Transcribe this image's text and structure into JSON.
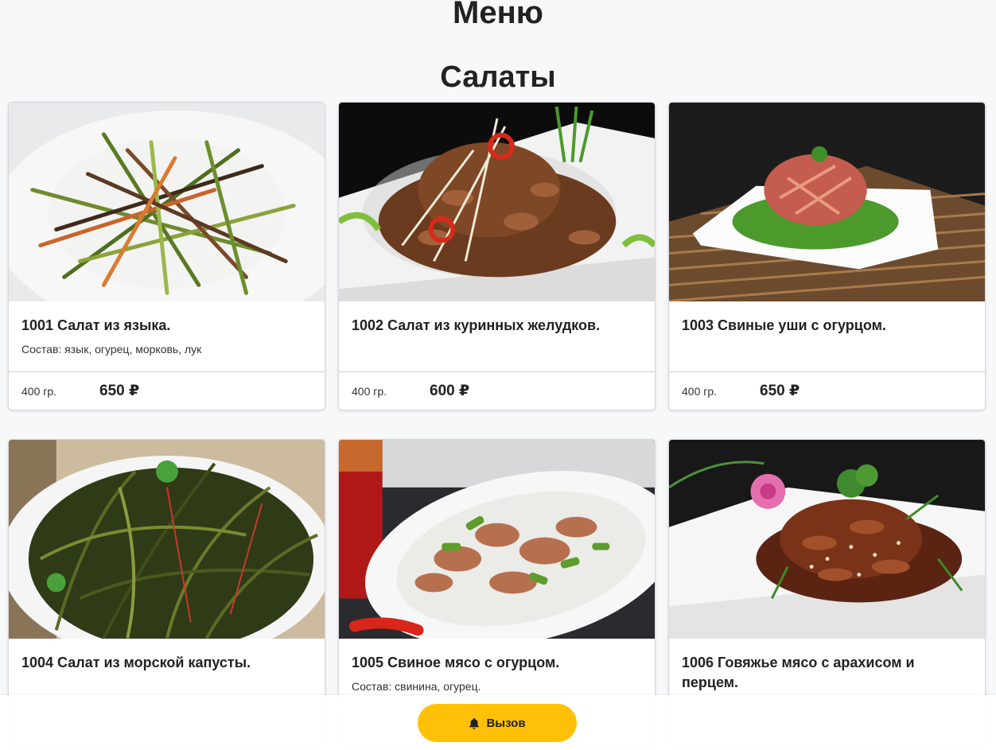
{
  "page": {
    "title": "Меню"
  },
  "section": {
    "title": "Салаты"
  },
  "dishes": [
    {
      "title": "1001 Салат из языка.",
      "ingredients": "Состав: язык, огурец, морковь, лук",
      "weight": "400 гр.",
      "price": "650 ₽",
      "photo": "tongue-salad-photo"
    },
    {
      "title": "1002 Салат из куринных желудков.",
      "ingredients": "",
      "weight": "400 гр.",
      "price": "600 ₽",
      "photo": "chicken-gizzard-salad-photo"
    },
    {
      "title": "1003 Свиные уши с огурцом.",
      "ingredients": "",
      "weight": "400 гр.",
      "price": "650 ₽",
      "photo": "pig-ear-salad-photo"
    },
    {
      "title": "1004 Салат из морской капусты.",
      "ingredients": "",
      "weight": "",
      "price": "",
      "photo": "seaweed-salad-photo"
    },
    {
      "title": "1005 Свиное мясо с огурцом.",
      "ingredients": "Состав: свинина, огурец.",
      "weight": "",
      "price": "",
      "photo": "pork-cucumber-photo"
    },
    {
      "title": "1006 Говяжье мясо с арахисом и перцем.",
      "ingredients": "",
      "weight": "",
      "price": "",
      "photo": "beef-peanut-pepper-photo"
    }
  ],
  "call_button": {
    "label": "Вызов",
    "icon": "bell-icon",
    "color": "#ffc107"
  }
}
